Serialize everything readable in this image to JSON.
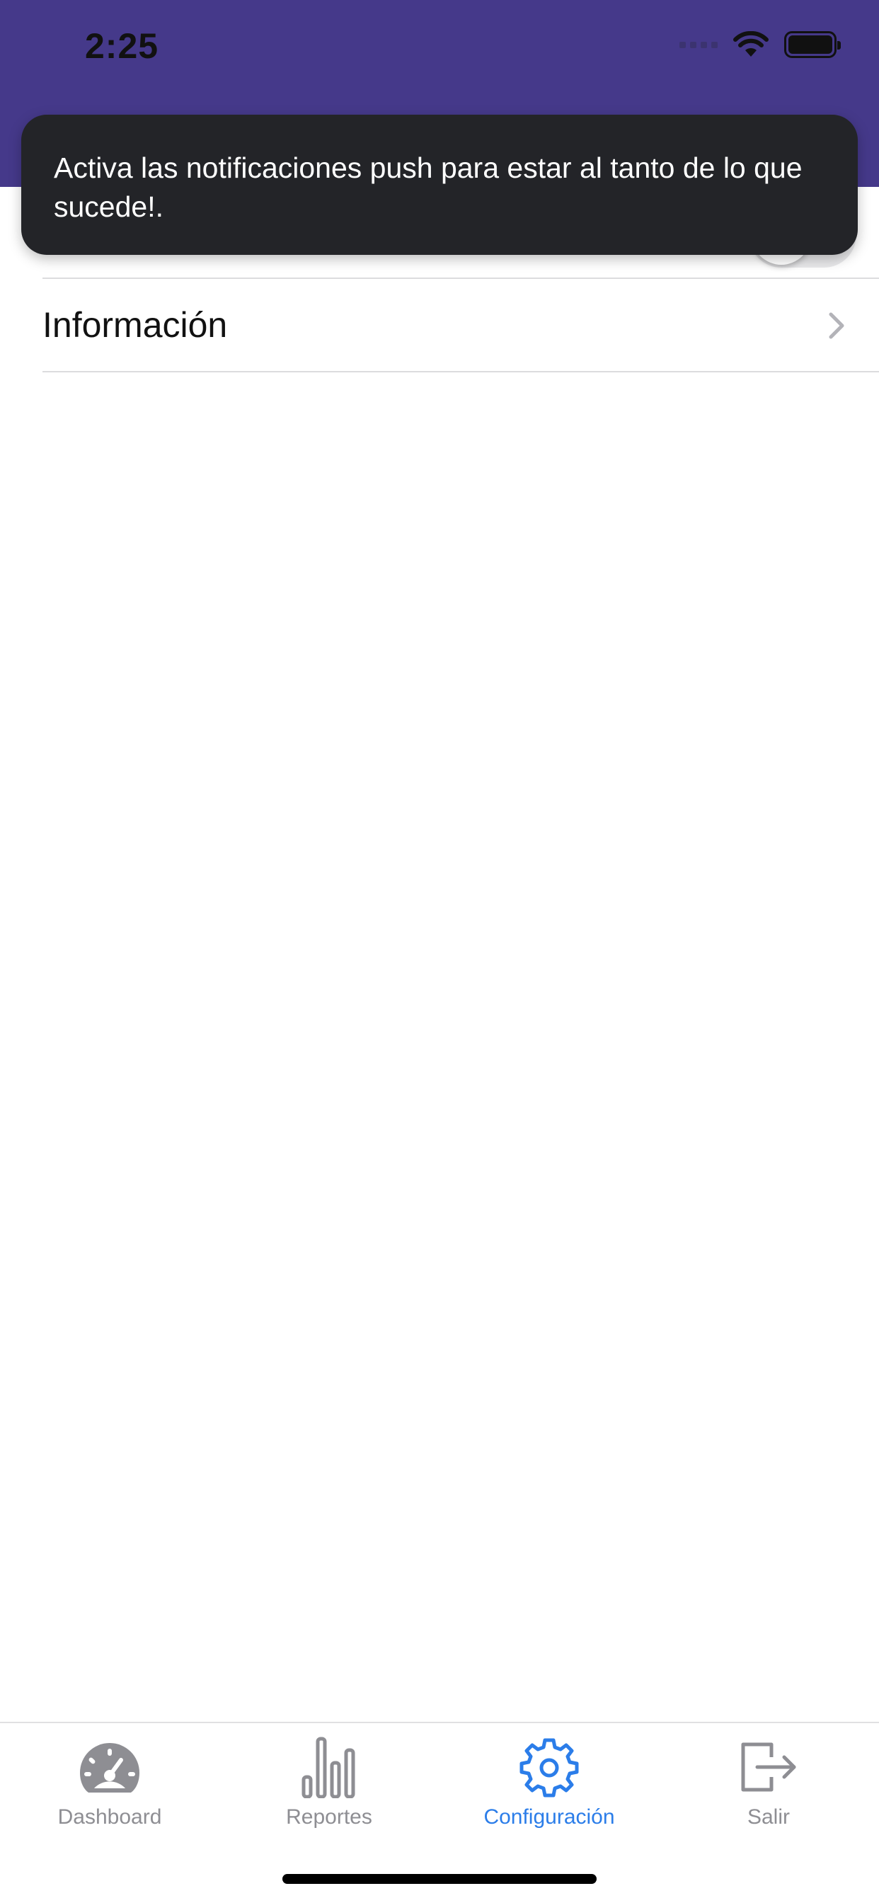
{
  "status_bar": {
    "time": "2:25"
  },
  "toast": {
    "message": "Activa las notificaciones push para estar al tanto de lo que sucede!."
  },
  "settings": {
    "push_toggle": {
      "on": false
    },
    "info_row": {
      "label": "Información"
    }
  },
  "tab_bar": {
    "tabs": [
      {
        "label": "Dashboard",
        "icon": "speedometer-icon",
        "active": false
      },
      {
        "label": "Reportes",
        "icon": "bar-chart-icon",
        "active": false
      },
      {
        "label": "Configuración",
        "icon": "gear-icon",
        "active": true
      },
      {
        "label": "Salir",
        "icon": "logout-icon",
        "active": false
      }
    ]
  },
  "colors": {
    "header": "#45398a",
    "accent": "#2b7de9",
    "inactive": "#8e8e93",
    "toast_bg": "#232428"
  }
}
